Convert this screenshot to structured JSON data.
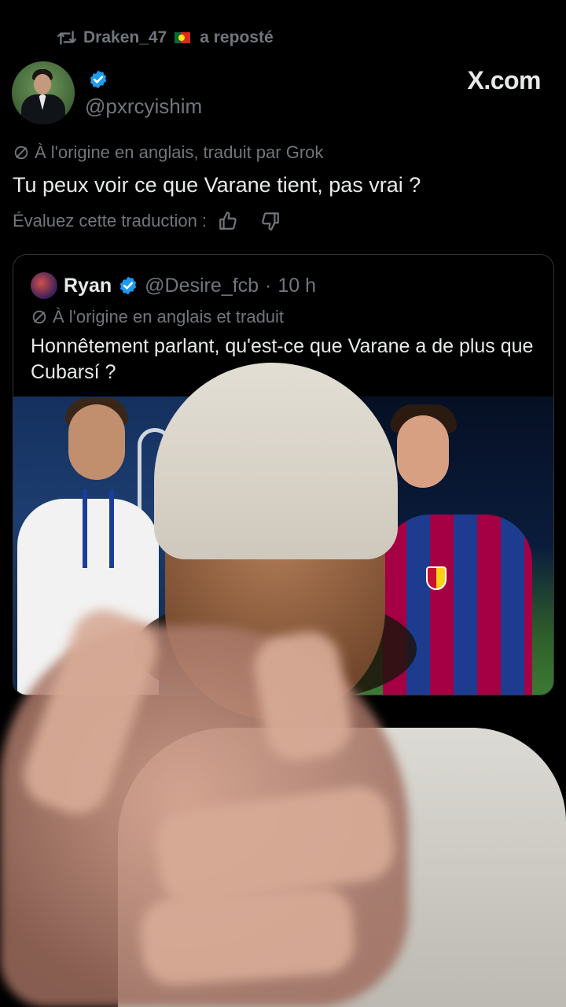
{
  "repost": {
    "user": "Draken_47",
    "label": "a reposté"
  },
  "tweet": {
    "handle": "@pxrcyishim",
    "brand": "X.com",
    "translation_note": "À l'origine en anglais, traduit par Grok",
    "text": "Tu peux voir ce que Varane tient, pas vrai ?",
    "rate_label": "Évaluez cette traduction :"
  },
  "quote": {
    "name": "Ryan",
    "handle": "@Desire_fcb",
    "separator": "·",
    "time": "10 h",
    "translation_note": "À l'origine en anglais et traduit",
    "text": "Honnêtement parlant, qu'est-ce que Varane a de plus que Cubarsí ?"
  },
  "colors": {
    "background": "#000000",
    "text": "#e7e9ea",
    "muted": "#71767b",
    "verified": "#1d9bf0",
    "border": "#2f3336"
  },
  "icons": [
    "repost-icon",
    "portugal-flag-icon",
    "verified-badge-icon",
    "translate-icon",
    "thumbs-up-icon",
    "thumbs-down-icon"
  ]
}
